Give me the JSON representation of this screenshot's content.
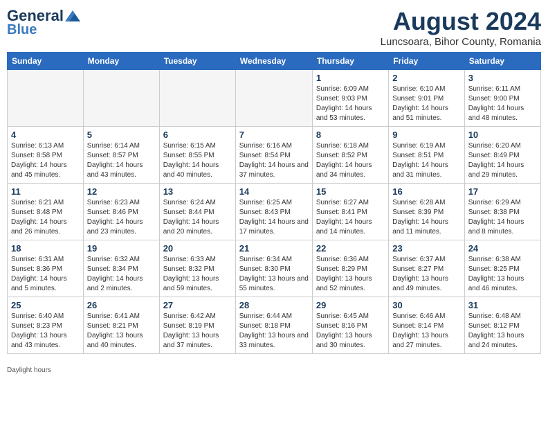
{
  "header": {
    "logo_general": "General",
    "logo_blue": "Blue",
    "month_title": "August 2024",
    "subtitle": "Luncsoara, Bihor County, Romania"
  },
  "days_of_week": [
    "Sunday",
    "Monday",
    "Tuesday",
    "Wednesday",
    "Thursday",
    "Friday",
    "Saturday"
  ],
  "weeks": [
    [
      {
        "day": "",
        "info": ""
      },
      {
        "day": "",
        "info": ""
      },
      {
        "day": "",
        "info": ""
      },
      {
        "day": "",
        "info": ""
      },
      {
        "day": "1",
        "sunrise": "6:09 AM",
        "sunset": "9:03 PM",
        "daylight": "14 hours and 53 minutes."
      },
      {
        "day": "2",
        "sunrise": "6:10 AM",
        "sunset": "9:01 PM",
        "daylight": "14 hours and 51 minutes."
      },
      {
        "day": "3",
        "sunrise": "6:11 AM",
        "sunset": "9:00 PM",
        "daylight": "14 hours and 48 minutes."
      }
    ],
    [
      {
        "day": "4",
        "sunrise": "6:13 AM",
        "sunset": "8:58 PM",
        "daylight": "14 hours and 45 minutes."
      },
      {
        "day": "5",
        "sunrise": "6:14 AM",
        "sunset": "8:57 PM",
        "daylight": "14 hours and 43 minutes."
      },
      {
        "day": "6",
        "sunrise": "6:15 AM",
        "sunset": "8:55 PM",
        "daylight": "14 hours and 40 minutes."
      },
      {
        "day": "7",
        "sunrise": "6:16 AM",
        "sunset": "8:54 PM",
        "daylight": "14 hours and 37 minutes."
      },
      {
        "day": "8",
        "sunrise": "6:18 AM",
        "sunset": "8:52 PM",
        "daylight": "14 hours and 34 minutes."
      },
      {
        "day": "9",
        "sunrise": "6:19 AM",
        "sunset": "8:51 PM",
        "daylight": "14 hours and 31 minutes."
      },
      {
        "day": "10",
        "sunrise": "6:20 AM",
        "sunset": "8:49 PM",
        "daylight": "14 hours and 29 minutes."
      }
    ],
    [
      {
        "day": "11",
        "sunrise": "6:21 AM",
        "sunset": "8:48 PM",
        "daylight": "14 hours and 26 minutes."
      },
      {
        "day": "12",
        "sunrise": "6:23 AM",
        "sunset": "8:46 PM",
        "daylight": "14 hours and 23 minutes."
      },
      {
        "day": "13",
        "sunrise": "6:24 AM",
        "sunset": "8:44 PM",
        "daylight": "14 hours and 20 minutes."
      },
      {
        "day": "14",
        "sunrise": "6:25 AM",
        "sunset": "8:43 PM",
        "daylight": "14 hours and 17 minutes."
      },
      {
        "day": "15",
        "sunrise": "6:27 AM",
        "sunset": "8:41 PM",
        "daylight": "14 hours and 14 minutes."
      },
      {
        "day": "16",
        "sunrise": "6:28 AM",
        "sunset": "8:39 PM",
        "daylight": "14 hours and 11 minutes."
      },
      {
        "day": "17",
        "sunrise": "6:29 AM",
        "sunset": "8:38 PM",
        "daylight": "14 hours and 8 minutes."
      }
    ],
    [
      {
        "day": "18",
        "sunrise": "6:31 AM",
        "sunset": "8:36 PM",
        "daylight": "14 hours and 5 minutes."
      },
      {
        "day": "19",
        "sunrise": "6:32 AM",
        "sunset": "8:34 PM",
        "daylight": "14 hours and 2 minutes."
      },
      {
        "day": "20",
        "sunrise": "6:33 AM",
        "sunset": "8:32 PM",
        "daylight": "13 hours and 59 minutes."
      },
      {
        "day": "21",
        "sunrise": "6:34 AM",
        "sunset": "8:30 PM",
        "daylight": "13 hours and 55 minutes."
      },
      {
        "day": "22",
        "sunrise": "6:36 AM",
        "sunset": "8:29 PM",
        "daylight": "13 hours and 52 minutes."
      },
      {
        "day": "23",
        "sunrise": "6:37 AM",
        "sunset": "8:27 PM",
        "daylight": "13 hours and 49 minutes."
      },
      {
        "day": "24",
        "sunrise": "6:38 AM",
        "sunset": "8:25 PM",
        "daylight": "13 hours and 46 minutes."
      }
    ],
    [
      {
        "day": "25",
        "sunrise": "6:40 AM",
        "sunset": "8:23 PM",
        "daylight": "13 hours and 43 minutes."
      },
      {
        "day": "26",
        "sunrise": "6:41 AM",
        "sunset": "8:21 PM",
        "daylight": "13 hours and 40 minutes."
      },
      {
        "day": "27",
        "sunrise": "6:42 AM",
        "sunset": "8:19 PM",
        "daylight": "13 hours and 37 minutes."
      },
      {
        "day": "28",
        "sunrise": "6:44 AM",
        "sunset": "8:18 PM",
        "daylight": "13 hours and 33 minutes."
      },
      {
        "day": "29",
        "sunrise": "6:45 AM",
        "sunset": "8:16 PM",
        "daylight": "13 hours and 30 minutes."
      },
      {
        "day": "30",
        "sunrise": "6:46 AM",
        "sunset": "8:14 PM",
        "daylight": "13 hours and 27 minutes."
      },
      {
        "day": "31",
        "sunrise": "6:48 AM",
        "sunset": "8:12 PM",
        "daylight": "13 hours and 24 minutes."
      }
    ]
  ],
  "footer": {
    "daylight_note": "Daylight hours"
  }
}
